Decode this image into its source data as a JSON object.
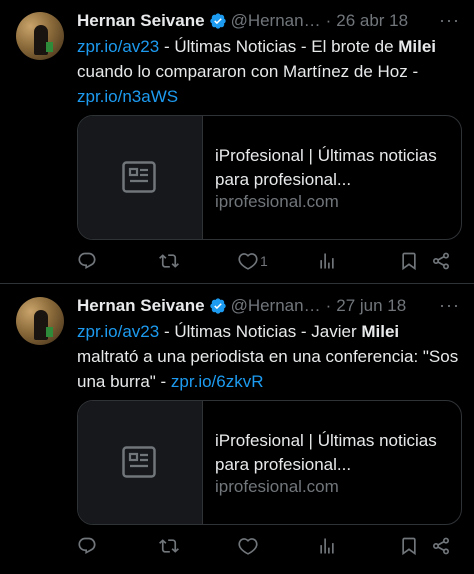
{
  "tweets": [
    {
      "author": "Hernan Seivane",
      "handle": "@Hernan…",
      "date": "26 abr 18",
      "separator": "·",
      "body_parts": [
        {
          "text": "zpr.io/av23",
          "style": "link"
        },
        {
          "text": " - Últimas Noticias - El brote de ",
          "style": "plain"
        },
        {
          "text": "Milei",
          "style": "bold"
        },
        {
          "text": " cuando lo compararon con Martínez de Hoz - ",
          "style": "plain"
        },
        {
          "text": "zpr.io/n3aWS",
          "style": "link"
        }
      ],
      "card": {
        "title": "iProfesional | Últimas noticias para profesional...",
        "domain": "iprofesional.com",
        "thumb_icon": "article-icon"
      },
      "actions": {
        "reply": "",
        "retweet": "",
        "like": "1",
        "views": "",
        "bookmark": "",
        "share": ""
      }
    },
    {
      "author": "Hernan Seivane",
      "handle": "@Hernan…",
      "date": "27 jun 18",
      "separator": "·",
      "body_parts": [
        {
          "text": "zpr.io/av23",
          "style": "link"
        },
        {
          "text": " - Últimas Noticias - Javier ",
          "style": "plain"
        },
        {
          "text": "Milei",
          "style": "bold"
        },
        {
          "text": " maltrató a una periodista en una conferencia: \"Sos una burra\" - ",
          "style": "plain"
        },
        {
          "text": "zpr.io/6zkvR",
          "style": "link"
        }
      ],
      "card": {
        "title": "iProfesional | Últimas noticias para profesional...",
        "domain": "iprofesional.com",
        "thumb_icon": "article-icon"
      },
      "actions": {
        "reply": "",
        "retweet": "",
        "like": "",
        "views": "",
        "bookmark": "",
        "share": ""
      }
    }
  ],
  "colors": {
    "background": "#000000",
    "text": "#e7e9ea",
    "muted": "#71767b",
    "link": "#1d9bf0",
    "verified": "#1d9bf0",
    "border": "#2f3336"
  }
}
